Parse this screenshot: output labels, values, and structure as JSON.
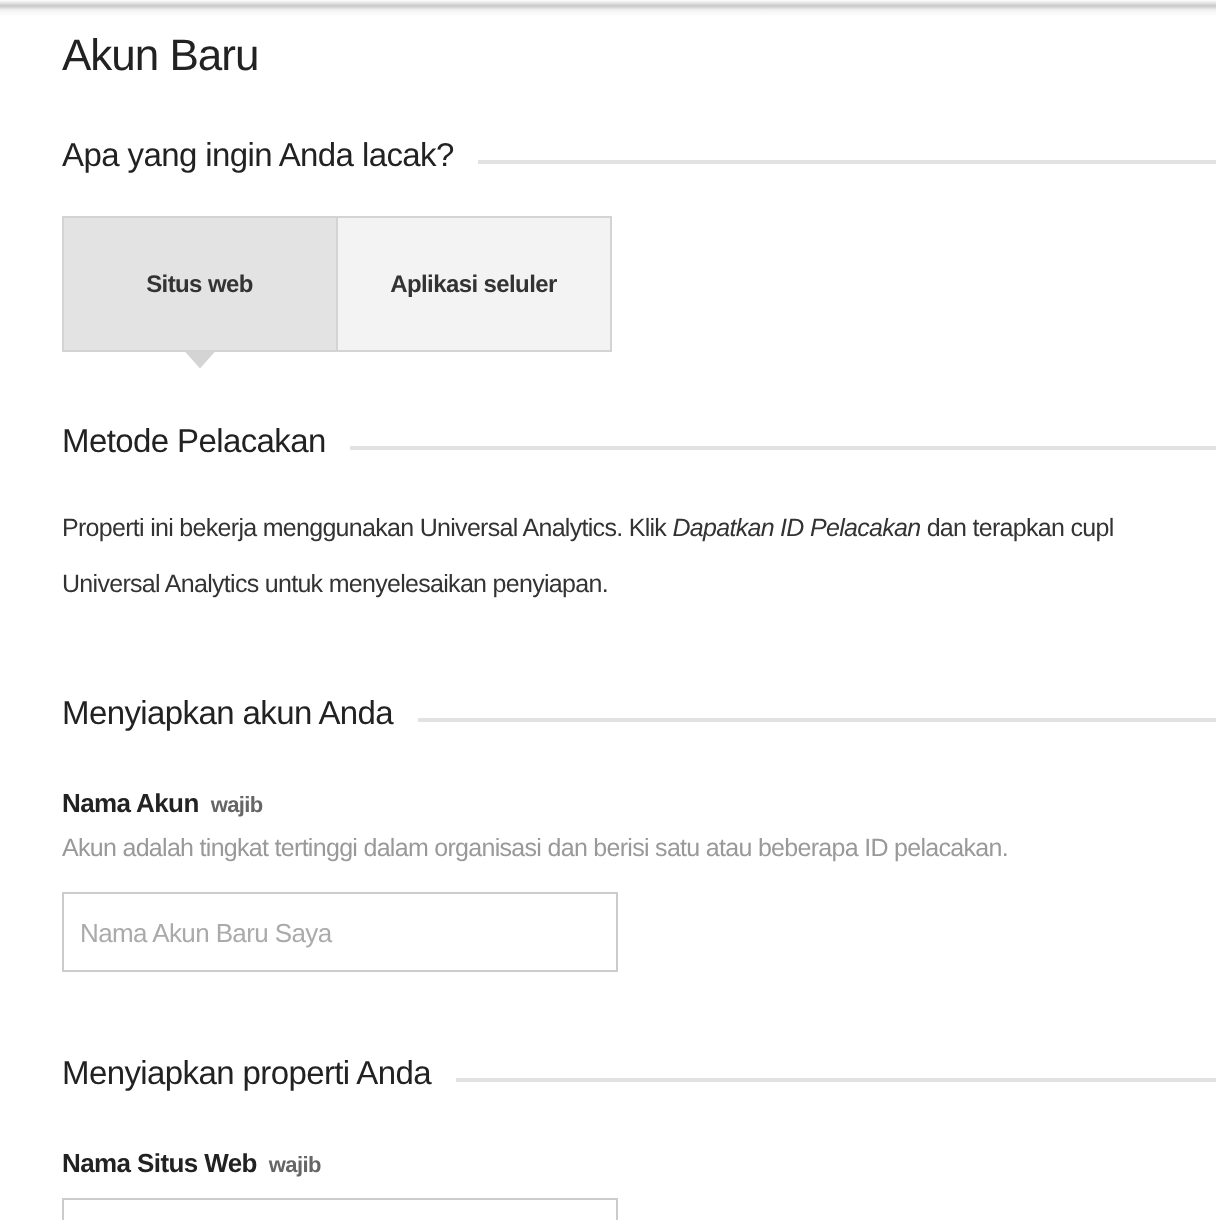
{
  "title": "Akun Baru",
  "sections": [
    {
      "kind": "tabs",
      "heading": "Apa yang ingin Anda lacak?",
      "tabs": [
        {
          "label": "Situs web",
          "selected": true
        },
        {
          "label": "Aplikasi seluler",
          "selected": false
        }
      ]
    },
    {
      "kind": "text",
      "heading": "Metode Pelacakan",
      "lines": [
        "Properti ini bekerja menggunakan Universal Analytics. Klik *Dapatkan ID Pelacakan* dan terapkan cupl",
        "Universal Analytics untuk menyelesaikan penyiapan."
      ]
    },
    {
      "kind": "field",
      "heading": "Menyiapkan akun Anda",
      "label": "Nama Akun",
      "required": "wajib",
      "hint": "Akun adalah tingkat tertinggi dalam organisasi dan berisi satu atau beberapa ID pelacakan.",
      "placeholder": "Nama Akun Baru Saya"
    },
    {
      "kind": "field",
      "heading": "Menyiapkan properti Anda",
      "label": "Nama Situs Web",
      "required": "wajib"
    }
  ]
}
